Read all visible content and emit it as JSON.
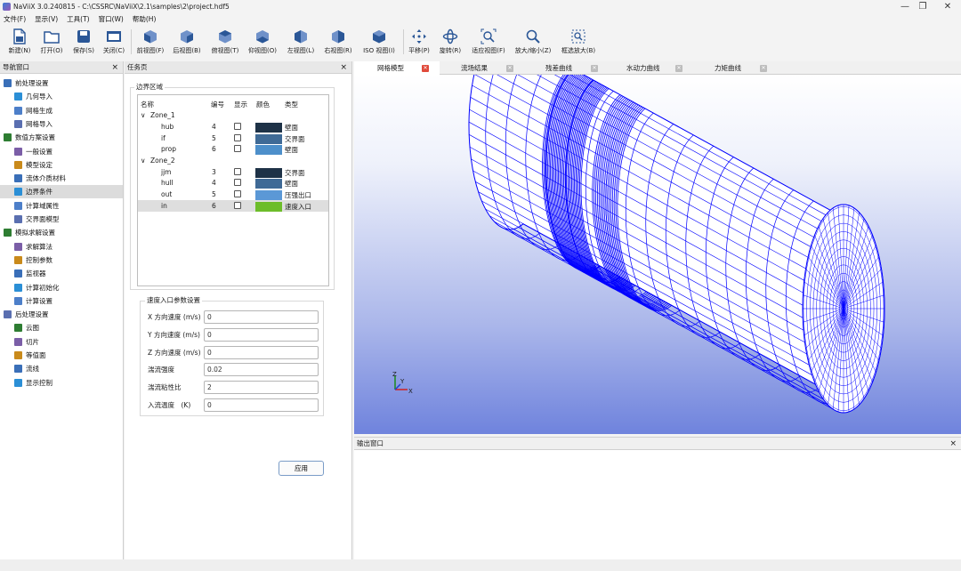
{
  "window": {
    "title": "NaViiX 3.0.240815 - C:\\CSSRC\\NaViiX\\2.1\\samples\\2\\project.hdf5",
    "minimize": "—",
    "restore": "❐",
    "close": "✕"
  },
  "menu": [
    "文件(F)",
    "显示(V)",
    "工具(T)",
    "窗口(W)",
    "帮助(H)"
  ],
  "toolbar": {
    "new": "新建(N)",
    "open": "打开(O)",
    "save": "保存(S)",
    "close": "关闭(C)",
    "front": "前视图(F)",
    "back": "后视图(B)",
    "side": "俯视图(T)",
    "bottom": "仰视图(O)",
    "left": "左视图(L)",
    "right": "右视图(R)",
    "iso": "ISO 视图(I)",
    "pan": "平移(P)",
    "rotate": "旋转(R)",
    "fit": "适应视图(F)",
    "zoom": "放大/缩小(Z)",
    "boxzoom": "框选放大(B)"
  },
  "nav": {
    "title": "导航窗口",
    "close": "×",
    "items": [
      {
        "label": "前处理设置",
        "level": 0
      },
      {
        "label": "几何导入",
        "level": 1
      },
      {
        "label": "网格生成",
        "level": 1
      },
      {
        "label": "网格导入",
        "level": 1
      },
      {
        "label": "数值方案设置",
        "level": 0
      },
      {
        "label": "一般设置",
        "level": 1
      },
      {
        "label": "模型设定",
        "level": 1
      },
      {
        "label": "流体介质材料",
        "level": 1
      },
      {
        "label": "边界条件",
        "level": 1
      },
      {
        "label": "计算域属性",
        "level": 1
      },
      {
        "label": "交界面模型",
        "level": 1
      },
      {
        "label": "模拟求解设置",
        "level": 0
      },
      {
        "label": "求解算法",
        "level": 1
      },
      {
        "label": "控制参数",
        "level": 1
      },
      {
        "label": "监视器",
        "level": 1
      },
      {
        "label": "计算初始化",
        "level": 1
      },
      {
        "label": "计算设置",
        "level": 1
      },
      {
        "label": "后处理设置",
        "level": 0
      },
      {
        "label": "云图",
        "level": 1
      },
      {
        "label": "切片",
        "level": 1
      },
      {
        "label": "等值面",
        "level": 1
      },
      {
        "label": "流线",
        "level": 1
      },
      {
        "label": "显示控制",
        "level": 1
      }
    ]
  },
  "task": {
    "title": "任务页",
    "close": "×",
    "boundary_group": "边界区域",
    "columns": [
      "名称",
      "编号",
      "显示",
      "颜色",
      "类型"
    ],
    "zones": [
      {
        "name": "Zone_1",
        "rows": [
          {
            "name": "hub",
            "id": "4",
            "color": "#1e3247",
            "type": "壁面"
          },
          {
            "name": "if",
            "id": "5",
            "color": "#3f6a96",
            "type": "交界面"
          },
          {
            "name": "prop",
            "id": "6",
            "color": "#4d8fca",
            "type": "壁面"
          }
        ]
      },
      {
        "name": "Zone_2",
        "rows": [
          {
            "name": "jjm",
            "id": "3",
            "color": "#1e3247",
            "type": "交界面"
          },
          {
            "name": "hull",
            "id": "4",
            "color": "#3f6a96",
            "type": "壁面"
          },
          {
            "name": "out",
            "id": "5",
            "color": "#5b98d6",
            "type": "压强出口"
          },
          {
            "name": "in",
            "id": "6",
            "color": "#6dbd2a",
            "type": "速度入口"
          }
        ]
      }
    ],
    "param_group": "速度入口参数设置",
    "fields": [
      {
        "label": "X 方向速度 (m/s)",
        "value": "0"
      },
      {
        "label": "Y 方向速度 (m/s)",
        "value": "0"
      },
      {
        "label": "Z 方向速度 (m/s)",
        "value": "0"
      },
      {
        "label": "湍流强度",
        "value": "0.02"
      },
      {
        "label": "湍流粘性比",
        "value": "2"
      },
      {
        "label": "入流温度　(K)",
        "value": "0"
      }
    ],
    "apply": "应用"
  },
  "view_tabs": [
    {
      "label": "网格模型",
      "close_color": "#e04a3b"
    },
    {
      "label": "流场结果",
      "close_color": "#a9a9a9"
    },
    {
      "label": "残差曲线",
      "close_color": "#a9a9a9"
    },
    {
      "label": "水动力曲线",
      "close_color": "#a9a9a9"
    },
    {
      "label": "力矩曲线",
      "close_color": "#a9a9a9"
    }
  ],
  "axes": {
    "x": "X",
    "y": "Y",
    "z": "Z"
  },
  "output": {
    "title": "输出窗口",
    "close": "×"
  },
  "colors": {
    "mesh": "#0000ff",
    "accent": "#2f6fd6"
  }
}
